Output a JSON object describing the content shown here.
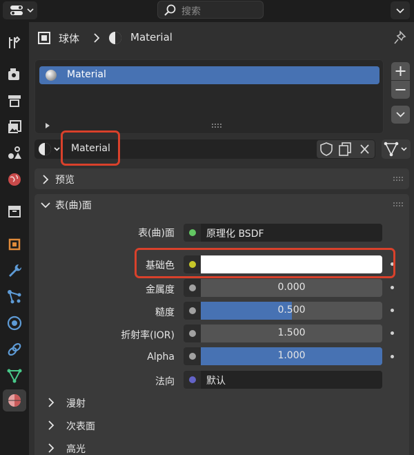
{
  "search": {
    "placeholder": "搜索"
  },
  "breadcrumb": {
    "object": "球体",
    "material": "Material"
  },
  "material_slots": [
    {
      "label": "Material"
    }
  ],
  "material": {
    "name": "Material"
  },
  "sections": {
    "preview": "预览",
    "surface": "表(曲)面"
  },
  "surface": {
    "shader_label": "表(曲)面",
    "shader_value": "原理化 BSDF",
    "base_color_label": "基础色",
    "base_color_value": "#ffffff",
    "metallic_label": "金属度",
    "metallic_value": "0.000",
    "metallic_fraction": 0.0,
    "roughness_label": "糙度",
    "roughness_value": "0.500",
    "roughness_fraction": 0.5,
    "ior_label": "折射率(IOR)",
    "ior_value": "1.500",
    "ior_fraction": 0.0,
    "alpha_label": "Alpha",
    "alpha_value": "1.000",
    "alpha_fraction": 1.0,
    "normal_label": "法向",
    "normal_value": "默认"
  },
  "subpanels": [
    "漫射",
    "次表面",
    "高光"
  ],
  "colors": {
    "accent": "#4772b3",
    "highlight": "#d9412b",
    "shader_socket": "#63c763",
    "color_socket": "#c7c729",
    "float_socket": "#a1a1a1",
    "vector_socket": "#6363c7"
  },
  "icons": {
    "editor_type": "properties-editor-icon",
    "tabs": [
      "tool-icon",
      "render-icon",
      "output-icon",
      "view-layer-icon",
      "scene-icon",
      "world-icon",
      "collection-icon",
      "object-icon",
      "modifier-icon",
      "particles-icon",
      "physics-icon",
      "constraints-icon",
      "data-icon",
      "material-icon"
    ]
  }
}
